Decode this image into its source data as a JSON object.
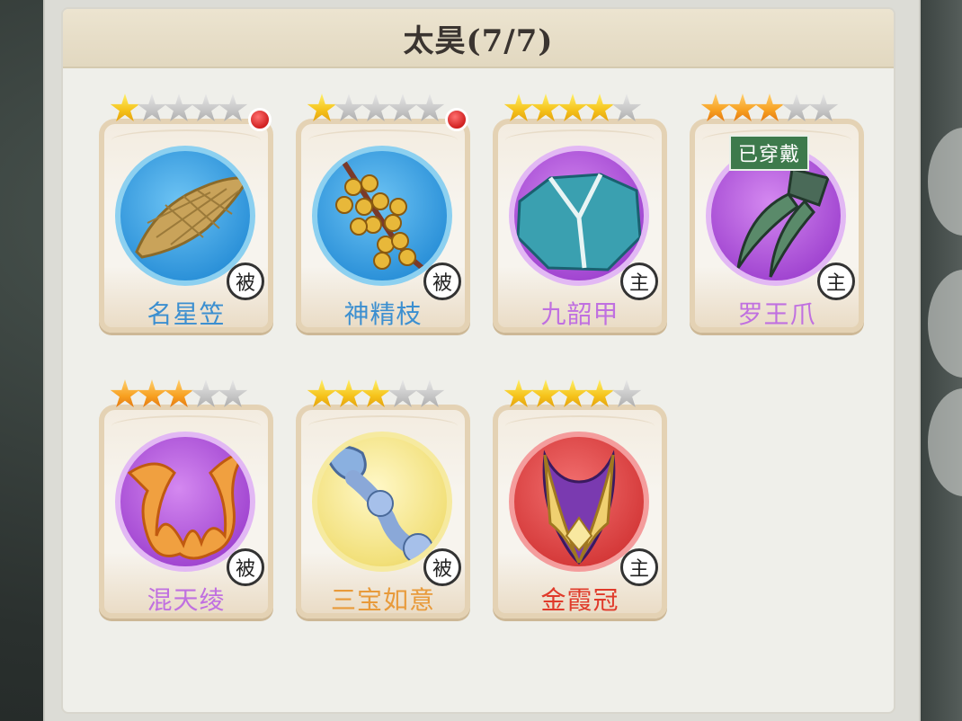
{
  "header": {
    "title": "太昊(7/7)"
  },
  "colors": {
    "name_blue": "#3c8fd0",
    "name_purple": "#c070e0",
    "name_orange": "#e89a3a",
    "name_red": "#e03a2a",
    "worn_badge": "#3d7a4c"
  },
  "items": [
    {
      "name": "名星笠",
      "stars": 1,
      "star_color": "gold",
      "badge": "被",
      "frame": "blue",
      "name_color": "#3c8fd0",
      "red_dot": true,
      "worn": false,
      "icon": "straw-hat-icon"
    },
    {
      "name": "神精枝",
      "stars": 1,
      "star_color": "gold",
      "badge": "被",
      "frame": "blue",
      "name_color": "#3c8fd0",
      "red_dot": true,
      "worn": false,
      "icon": "berry-branch-icon"
    },
    {
      "name": "九韶甲",
      "stars": 4,
      "star_color": "gold",
      "badge": "主",
      "frame": "purple",
      "name_color": "#c070e0",
      "red_dot": false,
      "worn": false,
      "icon": "robe-armor-icon"
    },
    {
      "name": "罗王爪",
      "stars": 3,
      "star_color": "orange",
      "badge": "主",
      "frame": "purple",
      "name_color": "#c070e0",
      "red_dot": false,
      "worn": true,
      "icon": "claw-icon"
    },
    {
      "name": "混天绫",
      "stars": 3,
      "star_color": "orange",
      "badge": "被",
      "frame": "purple",
      "name_color": "#c070e0",
      "red_dot": false,
      "worn": false,
      "icon": "ribbon-icon"
    },
    {
      "name": "三宝如意",
      "stars": 3,
      "star_color": "gold",
      "badge": "被",
      "frame": "yellow",
      "name_color": "#e89a3a",
      "red_dot": false,
      "worn": false,
      "icon": "ruyi-scepter-icon"
    },
    {
      "name": "金霞冠",
      "stars": 4,
      "star_color": "gold",
      "badge": "主",
      "frame": "red",
      "name_color": "#e03a2a",
      "red_dot": false,
      "worn": false,
      "icon": "crown-icon"
    }
  ],
  "max_stars": 5,
  "worn_label": "已穿戴"
}
